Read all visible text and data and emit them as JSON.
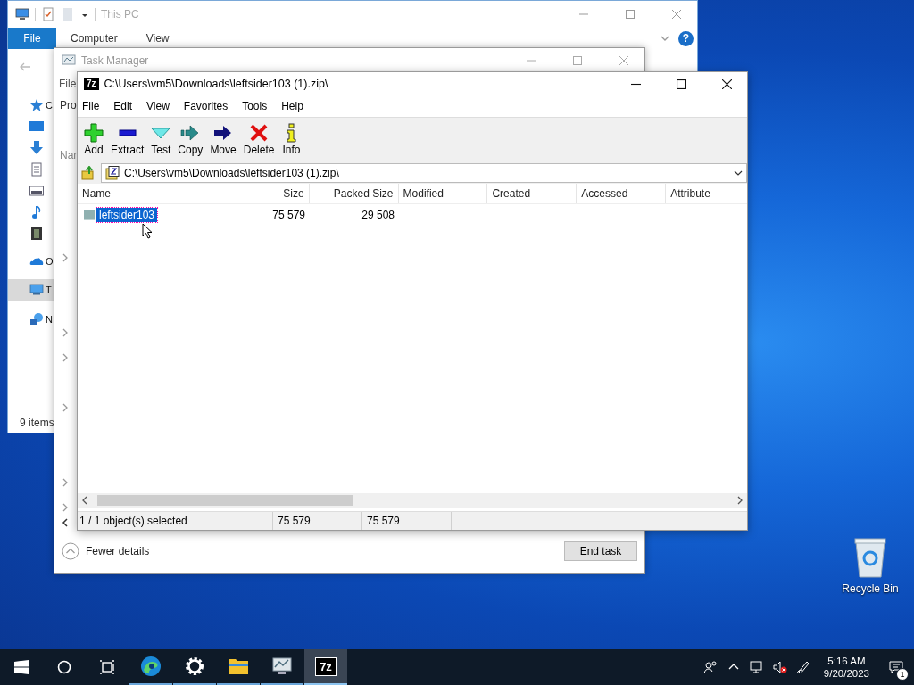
{
  "explorer": {
    "title": "This PC",
    "ribbon_tabs": [
      {
        "label": "File",
        "selected": true
      },
      {
        "label": "Computer",
        "selected": false
      },
      {
        "label": "View",
        "selected": false
      }
    ],
    "help_glyph": "?",
    "nav_items": [
      {
        "kind": "quick",
        "label": "C",
        "selected": false
      },
      {
        "kind": "desktop",
        "selected": false
      },
      {
        "kind": "downloads",
        "selected": false
      },
      {
        "kind": "documents",
        "selected": false
      },
      {
        "kind": "pictures",
        "selected": false
      },
      {
        "kind": "music",
        "selected": false
      },
      {
        "kind": "videos",
        "selected": false
      },
      {
        "kind": "onedrive",
        "label": "O",
        "selected": false
      },
      {
        "kind": "pc",
        "label": "T",
        "selected": true
      },
      {
        "kind": "network",
        "label": "N",
        "selected": false
      }
    ],
    "status": "9 items"
  },
  "task_manager": {
    "title": "Task Manager",
    "menu_fragment": "File",
    "tab_fragment": "Pro",
    "column_fragment": "Nar",
    "fewer_details": "Fewer details",
    "end_task": "End task"
  },
  "archiver": {
    "icon_text": "7z",
    "title": "C:\\Users\\vm5\\Downloads\\leftsider103 (1).zip\\",
    "menu": [
      "File",
      "Edit",
      "View",
      "Favorites",
      "Tools",
      "Help"
    ],
    "toolbar": [
      {
        "kind": "add",
        "label": "Add"
      },
      {
        "kind": "extract",
        "label": "Extract"
      },
      {
        "kind": "test",
        "label": "Test"
      },
      {
        "kind": "copy",
        "label": "Copy"
      },
      {
        "kind": "move",
        "label": "Move"
      },
      {
        "kind": "delete",
        "label": "Delete"
      },
      {
        "kind": "info",
        "label": "Info"
      }
    ],
    "address": "C:\\Users\\vm5\\Downloads\\leftsider103 (1).zip\\",
    "columns": [
      "Name",
      "Size",
      "Packed Size",
      "Modified",
      "Created",
      "Accessed",
      "Attribute"
    ],
    "rows": [
      {
        "name": "leftsider103",
        "size": "75 579",
        "packed_size": "29 508",
        "selected": true
      }
    ],
    "status": [
      "1 / 1 object(s) selected",
      "75 579",
      "75 579"
    ]
  },
  "recycle_bin": "Recycle Bin",
  "taskbar": {
    "apps": [
      {
        "kind": "edge",
        "selected": false
      },
      {
        "kind": "settings",
        "selected": false
      },
      {
        "kind": "folder",
        "selected": false
      },
      {
        "kind": "taskmgr",
        "selected": false
      },
      {
        "kind": "sevenzip",
        "label": "7z",
        "selected": true
      }
    ],
    "time": "5:16 AM",
    "date": "9/20/2023",
    "notification_count": "1"
  }
}
